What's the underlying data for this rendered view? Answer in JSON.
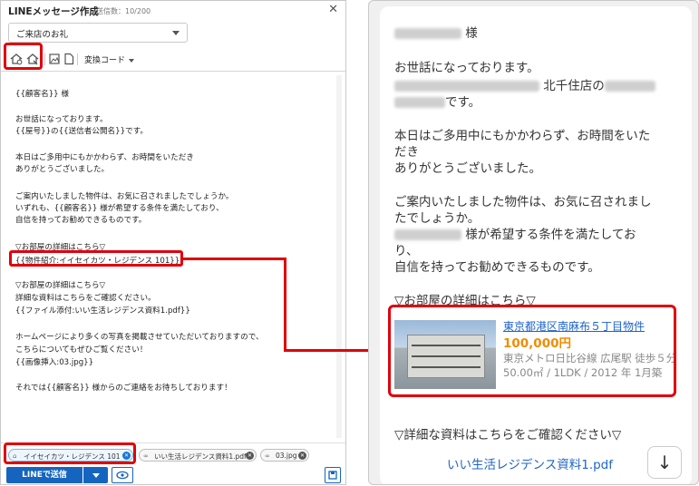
{
  "compose": {
    "title": "LINEメッセージ作成",
    "count": "送信数：10/200",
    "close": "✕",
    "template": "ご来店のお礼",
    "convert_code": "変換コード",
    "editor_lines": [
      "{{顧客名}} 様",
      "お世話になっております。",
      "{{屋号}}の{{送信者公開名}}です。",
      "本日はご多用中にもかかわらず、お時間をいただき",
      "ありがとうございました。",
      "ご案内いたしました物件は、お気に召されましたでしょうか。",
      "いずれも、{{顧客名}} 様が希望する条件を満たしており、",
      "自信を持ってお勧めできるものです。",
      "▽お部屋の詳細はこちら▽",
      "{{物件紹介:イイセイカツ・レジデンス 101}}",
      "▽お部屋の詳細はこちら▽",
      "詳細な資料はこちらをご確認ください。",
      "{{ファイル添付:いい生活レジデンス資料1.pdf}}",
      "ホームページにより多くの写真を掲載させていただいておりますので、",
      "こちらについてもぜひご覧ください！",
      "{{画像挿入:03.jpg}}",
      "それでは{{顧客名}} 様からのご連絡をお待ちしております！"
    ],
    "attachments": [
      {
        "label": "イイセイカツ・レジデンス 101"
      },
      {
        "label": "いい生活レジデンス資料1.pdf"
      },
      {
        "label": "03.jpg"
      }
    ],
    "send_label": "LINEで送信"
  },
  "preview": {
    "honorific": "様",
    "line_greeting": "お世話になっております。",
    "line_store": "北千住店の",
    "line_desu": "です。",
    "line_thanks1": "本日はご多用中にもかかわらず、お時間をいた",
    "line_thanks2": "だき",
    "line_thanks3": "ありがとうございました。",
    "line_guide1": "ご案内いたしました物件は、お気に召されまし",
    "line_guide2": "たでしょうか。",
    "line_cond1": "様が希望する条件を満たしてお",
    "line_cond2": "り、",
    "line_confident": "自信を持ってお勧めできるものです。",
    "detail_header": "▽お部屋の詳細はこちら▽",
    "card": {
      "title": "東京都港区南麻布５丁目物件",
      "price": "100,000円",
      "access": "東京メトロ日比谷線 広尾駅 徒歩５分",
      "spec": "50.00㎡ / 1LDK / 2012 年 1月築"
    },
    "docs_header": "▽詳細な資料はこちらをご確認ください▽",
    "file_link": "いい生活レジデンス資料1.pdf",
    "down_arrow": "↓"
  }
}
